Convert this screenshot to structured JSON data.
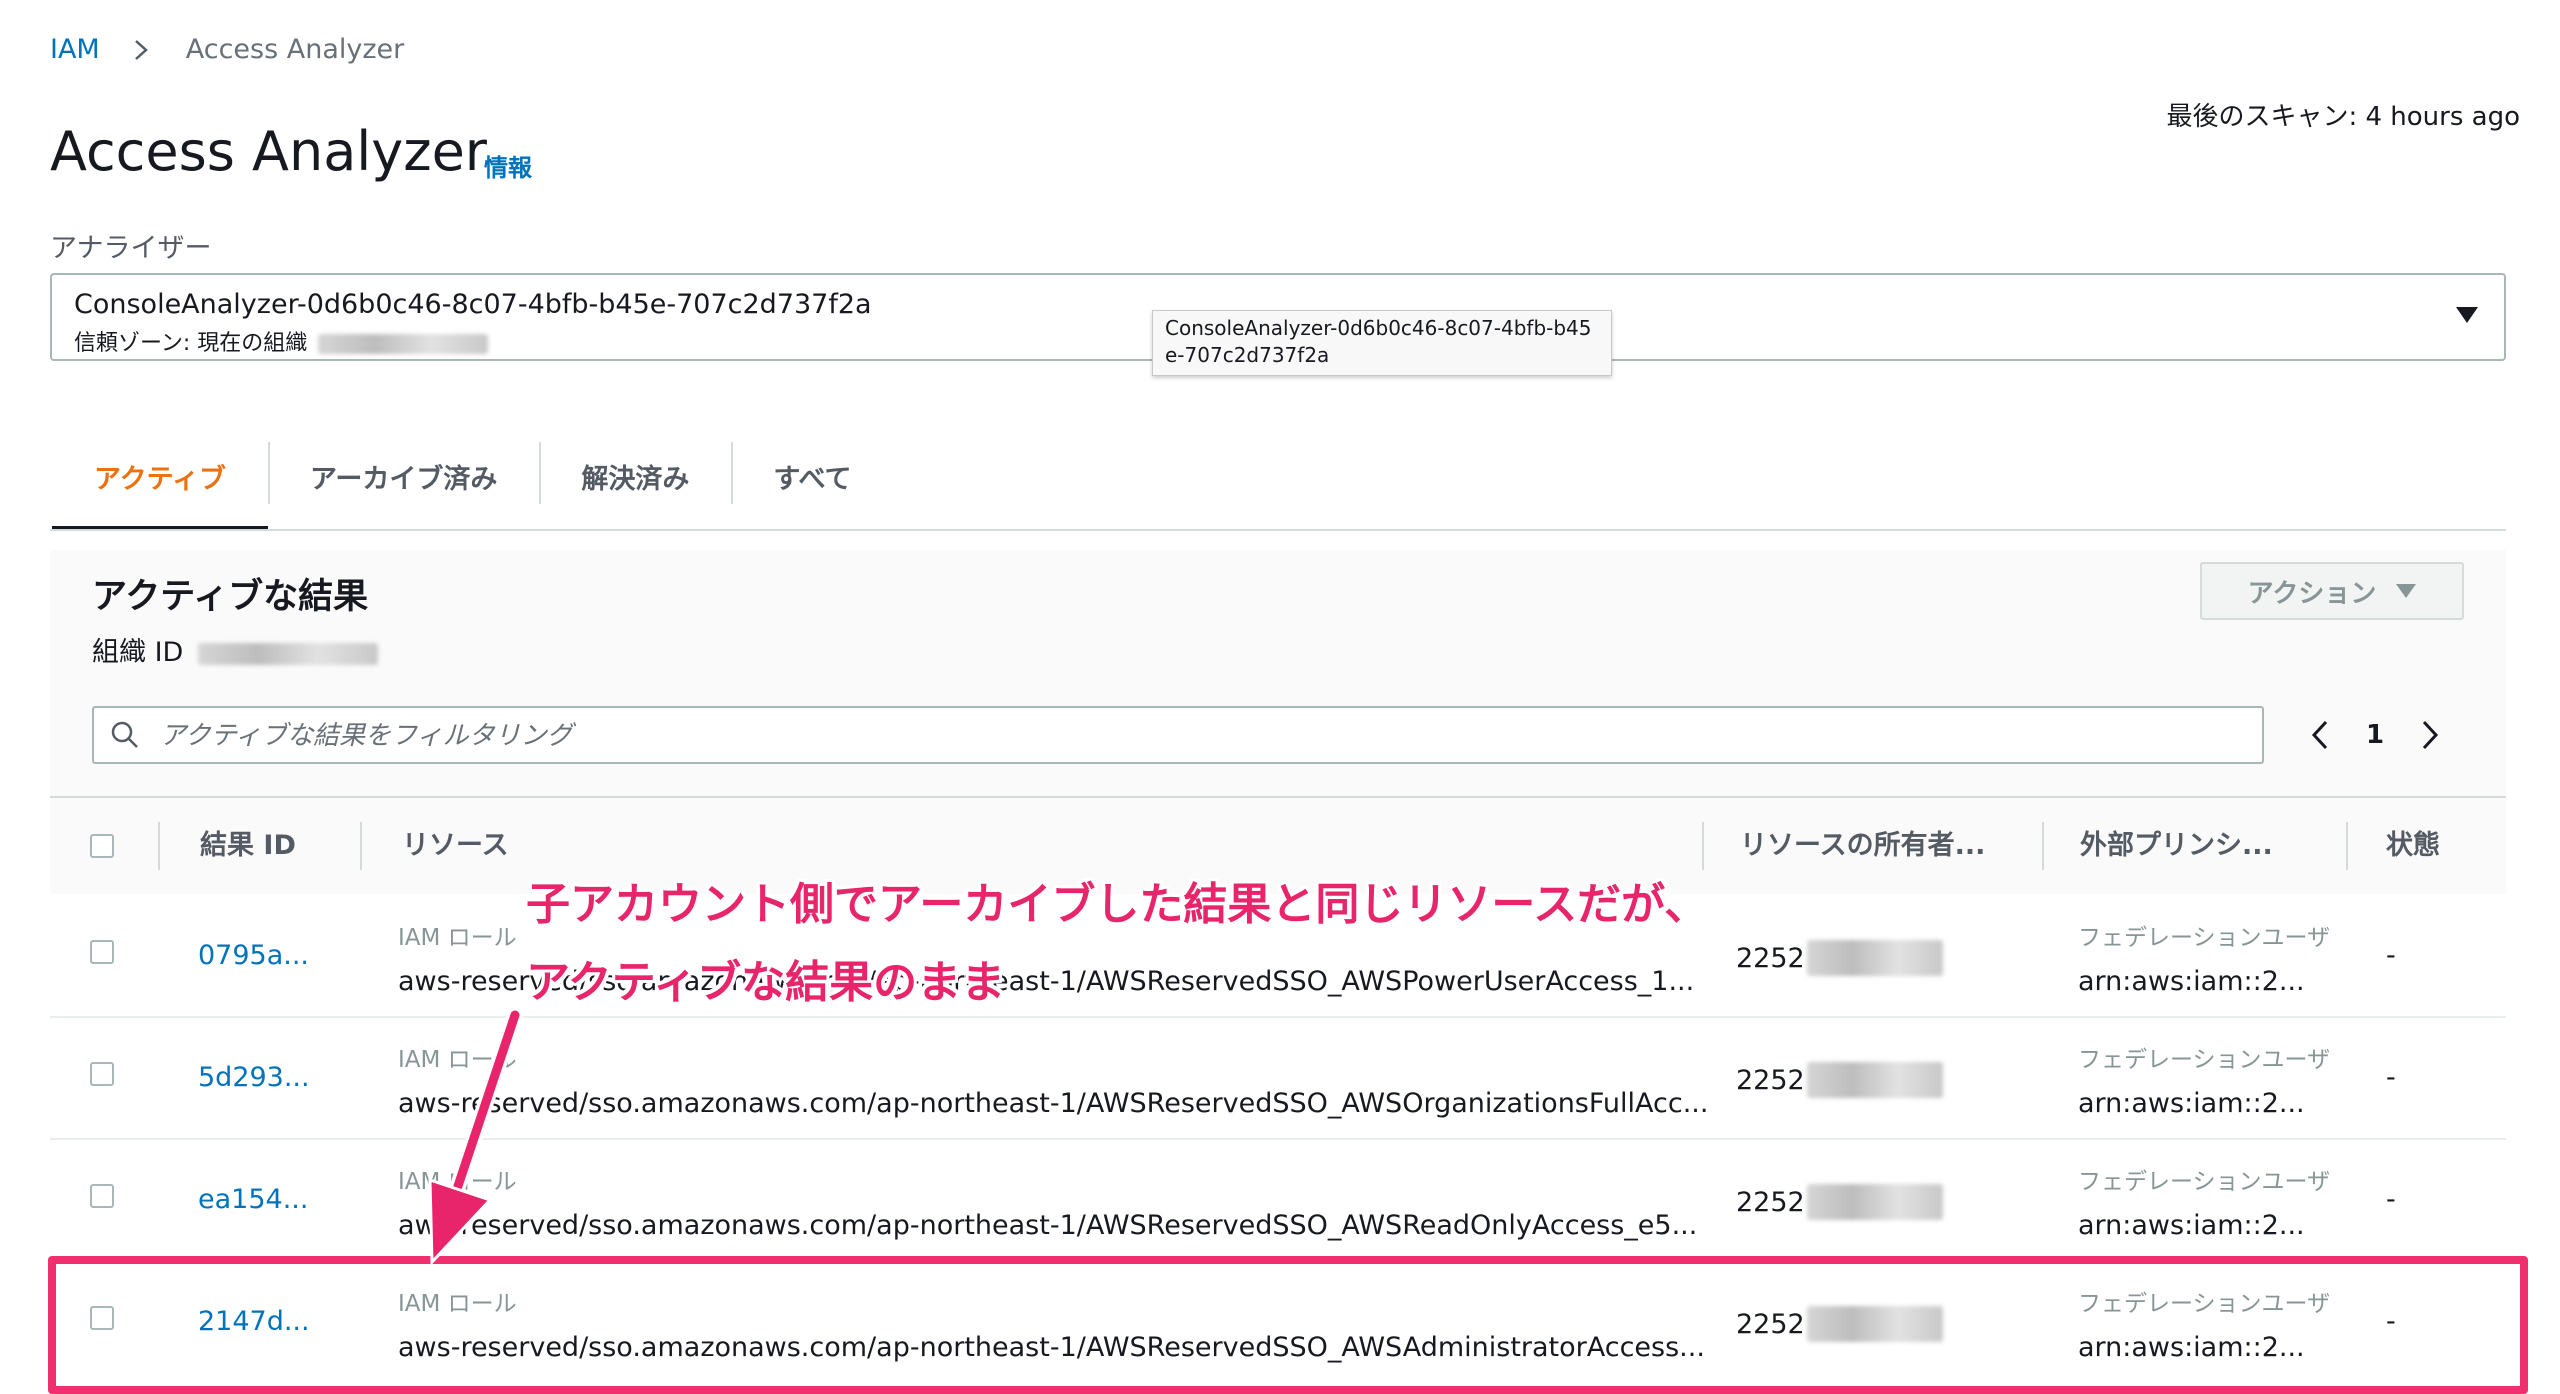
{
  "breadcrumb": {
    "root": "IAM",
    "current": "Access Analyzer"
  },
  "header": {
    "title": "Access Analyzer",
    "info": "情報",
    "last_scan": "最後のスキャン: 4 hours ago"
  },
  "analyzer": {
    "label": "アナライザー",
    "selected": "ConsoleAnalyzer-0d6b0c46-8c07-4bfb-b45e-707c2d737f2a",
    "trust_zone": "信頼ゾーン: 現在の組織",
    "tooltip": "ConsoleAnalyzer-0d6b0c46-8c07-4bfb-b45e-707c2d737f2a"
  },
  "tabs": [
    {
      "label": "アクティブ"
    },
    {
      "label": "アーカイブ済み"
    },
    {
      "label": "解決済み"
    },
    {
      "label": "すべて"
    }
  ],
  "panel": {
    "title": "アクティブな結果",
    "org_id_label": "組織 ID",
    "actions": "アクション",
    "filter_placeholder": "アクティブな結果をフィルタリング",
    "page": "1"
  },
  "table": {
    "columns": {
      "id": "結果 ID",
      "resource": "リソース",
      "owner": "リソースの所有者...",
      "principal": "外部プリンシ...",
      "status": "状態"
    },
    "rows": [
      {
        "id": "0795a...",
        "type": "IAM ロール",
        "resource": "aws-reserved/sso.amazonaws.com/ap-northeast-1/AWSReservedSSO_AWSPowerUserAccess_1...",
        "owner": "2252",
        "principal_type": "フェデレーションユーザ",
        "principal": "arn:aws:iam::2...",
        "status": "-"
      },
      {
        "id": "5d293...",
        "type": "IAM ロール",
        "resource": "aws-reserved/sso.amazonaws.com/ap-northeast-1/AWSReservedSSO_AWSOrganizationsFullAcc...",
        "owner": "2252",
        "principal_type": "フェデレーションユーザ",
        "principal": "arn:aws:iam::2...",
        "status": "-"
      },
      {
        "id": "ea154...",
        "type": "IAM ロール",
        "resource": "aws-reserved/sso.amazonaws.com/ap-northeast-1/AWSReservedSSO_AWSReadOnlyAccess_e5...",
        "owner": "2252",
        "principal_type": "フェデレーションユーザ",
        "principal": "arn:aws:iam::2...",
        "status": "-"
      },
      {
        "id": "2147d...",
        "type": "IAM ロール",
        "resource": "aws-reserved/sso.amazonaws.com/ap-northeast-1/AWSReservedSSO_AWSAdministratorAccess...",
        "owner": "2252",
        "principal_type": "フェデレーションユーザ",
        "principal": "arn:aws:iam::2...",
        "status": "-"
      }
    ]
  },
  "annotation": {
    "line1": "子アカウント側でアーカイブした結果と同じリソースだが、",
    "line2": "アクティブな結果のまま",
    "color": "#e8246a"
  },
  "colors": {
    "link": "#0073bb",
    "active_tab": "#ec7211",
    "highlight": "#f0306e"
  }
}
